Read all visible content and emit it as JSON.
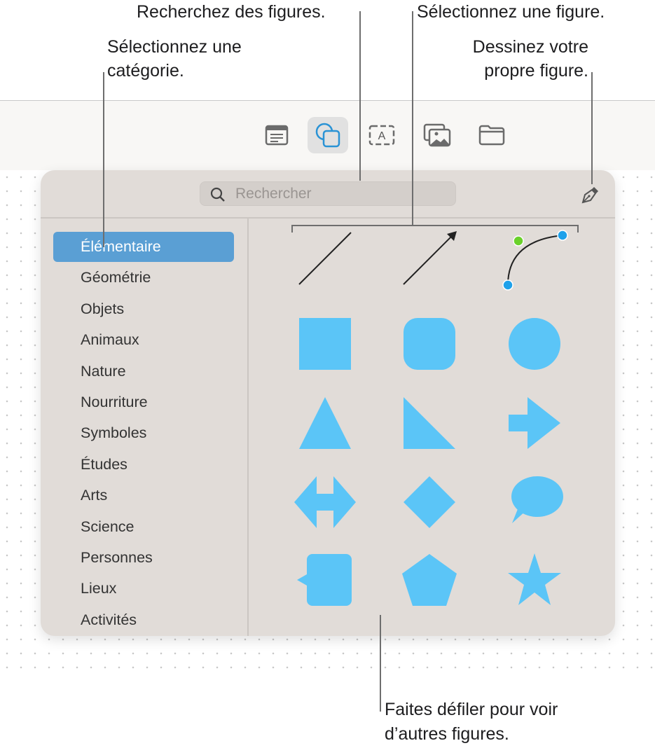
{
  "callouts": {
    "search": "Recherchez des figures.",
    "select_shape": "Sélectionnez une figure.",
    "category_line1": "Sélectionnez une",
    "category_line2": "catégorie.",
    "draw_line1": "Dessinez votre",
    "draw_line2": "propre figure.",
    "scroll_line1": "Faites défiler pour voir",
    "scroll_line2": "d’autres figures."
  },
  "toolbar": {
    "buttons": [
      {
        "icon": "text-box-icon"
      },
      {
        "icon": "shapes-icon",
        "selected": true
      },
      {
        "icon": "text-field-icon"
      },
      {
        "icon": "media-icon"
      },
      {
        "icon": "folder-icon"
      }
    ]
  },
  "popover": {
    "search_placeholder": "Rechercher",
    "accent": "#5a9fd4",
    "shape_color": "#5bc5f7",
    "categories": [
      "Élémentaire",
      "Géométrie",
      "Objets",
      "Animaux",
      "Nature",
      "Nourriture",
      "Symboles",
      "Études",
      "Arts",
      "Science",
      "Personnes",
      "Lieux",
      "Activités"
    ],
    "selected_category": "Élémentaire",
    "shapes": [
      "line",
      "arrow-line",
      "curve",
      "square",
      "rounded-square",
      "circle",
      "triangle",
      "right-triangle",
      "arrow",
      "double-arrow",
      "diamond",
      "speech-bubble",
      "callout-square",
      "pentagon",
      "star"
    ]
  }
}
